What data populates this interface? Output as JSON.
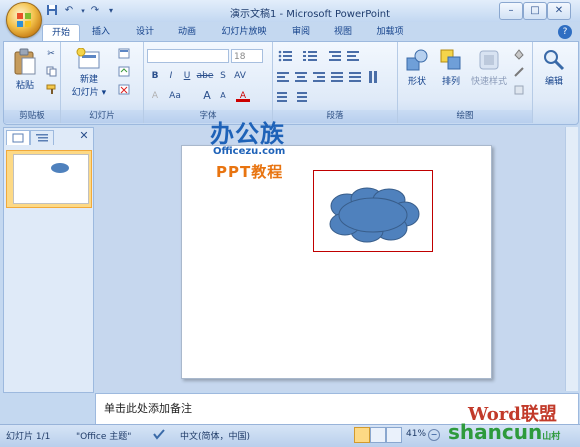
{
  "window": {
    "title": "演示文稿1 - Microsoft PowerPoint",
    "controls": {
      "minimize": "–",
      "maximize": "□",
      "close": "✕"
    }
  },
  "quick_access": {
    "save": "💾",
    "undo": "↶",
    "redo": "↷",
    "customize": "▾"
  },
  "tabs": [
    {
      "label": "开始"
    },
    {
      "label": "插入"
    },
    {
      "label": "设计"
    },
    {
      "label": "动画"
    },
    {
      "label": "幻灯片放映"
    },
    {
      "label": "审阅"
    },
    {
      "label": "视图"
    },
    {
      "label": "加载项"
    }
  ],
  "ribbon": {
    "clipboard": {
      "label": "剪贴板",
      "paste": "粘贴"
    },
    "slides": {
      "label": "幻灯片",
      "new_slide": "新建",
      "new_slide_2": "幻灯片 ▾"
    },
    "font": {
      "label": "字体",
      "size": "18",
      "bold": "B",
      "italic": "I",
      "underline": "U",
      "strike": "abe",
      "shadow": "S",
      "spacing": "AV",
      "case": "Aa",
      "grow": "A",
      "shrink": "A"
    },
    "paragraph": {
      "label": "段落"
    },
    "drawing": {
      "label": "绘图",
      "shapes": "形状",
      "arrange": "排列",
      "quick_styles": "快速样式"
    },
    "editing": {
      "label": "编辑"
    }
  },
  "slide_pane": {
    "slide_number": "1"
  },
  "slide_content": {
    "watermark_cn": "办公族",
    "watermark_url": "Officezu.com",
    "watermark_ppt": "PPT教程"
  },
  "notes": {
    "placeholder": "单击此处添加备注"
  },
  "statusbar": {
    "slide_info": "幻灯片 1/1",
    "theme": "\"Office 主题\"",
    "language": "中文(简体，中国)",
    "zoom": "41%"
  },
  "corner_watermark": {
    "brand_a": "Word联盟",
    "brand_b": "shancun",
    "brand_b_suffix": "山村"
  },
  "colors": {
    "accent": "#4f81bd",
    "selection": "#c00000",
    "ribbon": "#dfeaf8"
  }
}
